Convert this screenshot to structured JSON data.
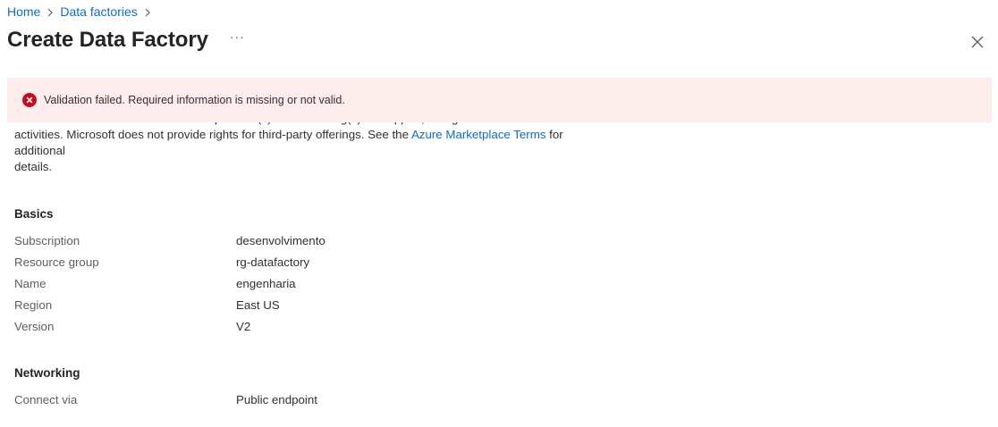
{
  "breadcrumb": {
    "items": [
      "Home",
      "Data factories"
    ]
  },
  "header": {
    "title": "Create Data Factory",
    "more_label": "···"
  },
  "banner": {
    "message": "Validation failed. Required information is missing or not valid.",
    "status_color": "#c50f1f",
    "icon": "error-circle-icon"
  },
  "terms": {
    "line1": "and transactional information with the provider(s) of the offering(s) for support, billing and other transactional",
    "line2_before": "activities. Microsoft does not provide rights for third-party offerings. See the ",
    "link": "Azure Marketplace Terms",
    "line2_after": " for additional",
    "line3": "details."
  },
  "basics": {
    "title": "Basics",
    "rows": [
      {
        "label": "Subscription",
        "value": "desenvolvimento"
      },
      {
        "label": "Resource group",
        "value": "rg-datafactory"
      },
      {
        "label": "Name",
        "value": "engenharia"
      },
      {
        "label": "Region",
        "value": "East US"
      },
      {
        "label": "Version",
        "value": "V2"
      }
    ]
  },
  "networking": {
    "title": "Networking",
    "rows": [
      {
        "label": "Connect via",
        "value": "Public endpoint"
      }
    ]
  },
  "colors": {
    "link": "#0f6cbd",
    "banner_bg": "#fdeded"
  }
}
